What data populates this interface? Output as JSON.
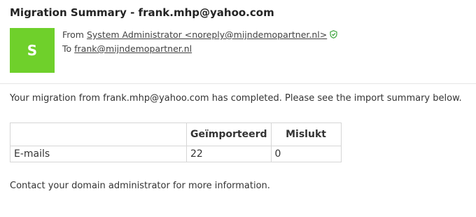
{
  "email": {
    "subject": "Migration Summary - frank.mhp@yahoo.com",
    "avatar_letter": "S",
    "avatar_color": "#6fd02b",
    "from_label": "From",
    "from_value": "System Administrator <noreply@mijndemopartner.nl>",
    "verified_icon": "shield-check-icon",
    "to_label": "To",
    "to_value": "frank@mijndemopartner.nl"
  },
  "body": {
    "intro": "Your migration from frank.mhp@yahoo.com has completed. Please see the import summary below.",
    "table": {
      "headers": [
        "",
        "Geïmporteerd",
        "Mislukt"
      ],
      "rows": [
        [
          "E-mails",
          "22",
          "0"
        ]
      ]
    },
    "footer": "Contact your domain administrator for more information."
  }
}
